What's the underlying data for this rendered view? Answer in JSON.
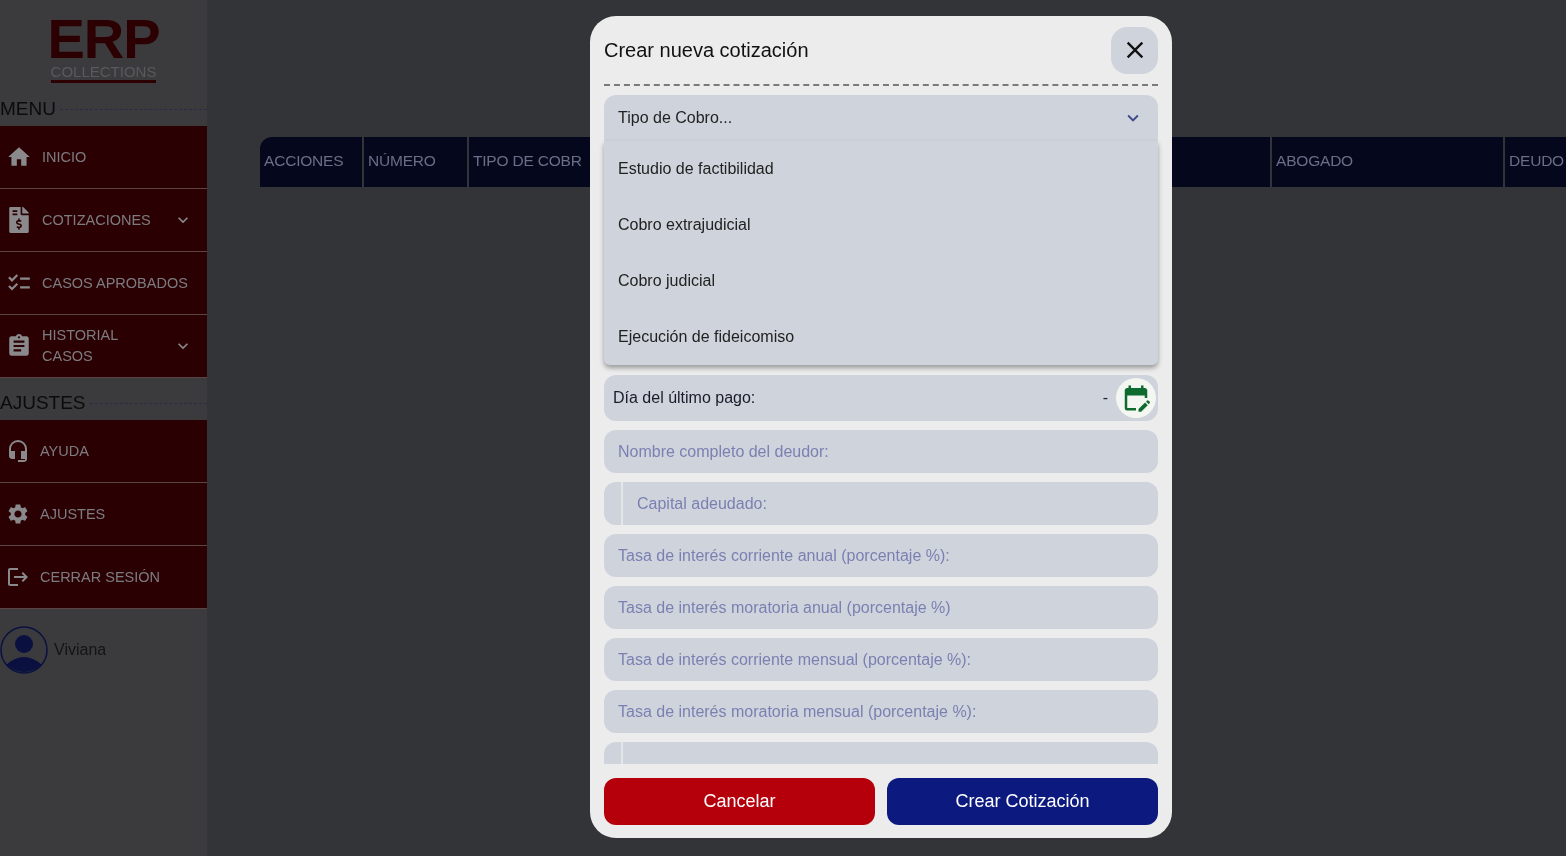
{
  "sidebar": {
    "logo": {
      "title": "ERP",
      "subtitle": "COLLECTIONS"
    },
    "sections": [
      {
        "title": "MENU",
        "items": [
          {
            "label": "INICIO",
            "has_submenu": false
          },
          {
            "label": "COTIZACIONES",
            "has_submenu": true
          },
          {
            "label": "CASOS APROBADOS",
            "has_submenu": false
          },
          {
            "label": "HISTORIAL CASOS",
            "has_submenu": true
          }
        ]
      },
      {
        "title": "AJUSTES",
        "items": [
          {
            "label": "AYUDA",
            "has_submenu": false
          },
          {
            "label": "AJUSTES",
            "has_submenu": false
          },
          {
            "label": "CERRAR SESIÓN",
            "has_submenu": false
          }
        ]
      }
    ],
    "user": {
      "name": "Viviana"
    }
  },
  "table": {
    "columns": [
      "ACCIONES",
      "NÚMERO",
      "TIPO DE COBR",
      "ABOGADO",
      "DEUDO"
    ]
  },
  "modal": {
    "title": "Crear nueva cotización",
    "select": {
      "placeholder": "Tipo de Cobro...",
      "expanded": true,
      "options": [
        "Estudio de factibilidad",
        "Cobro extrajudicial",
        "Cobro judicial",
        "Ejecución de fideicomiso"
      ]
    },
    "fields": [
      {
        "kind": "date",
        "label": "Día del último pago:",
        "value": "-"
      },
      {
        "kind": "text",
        "placeholder": "Nombre completo del deudor:"
      },
      {
        "kind": "money",
        "placeholder": "Capital adeudado:"
      },
      {
        "kind": "text",
        "placeholder": "Tasa de interés corriente anual (porcentaje %):"
      },
      {
        "kind": "text",
        "placeholder": "Tasa de interés moratoria anual (porcentaje %)"
      },
      {
        "kind": "text",
        "placeholder": "Tasa de interés corriente mensual (porcentaje %):"
      },
      {
        "kind": "text",
        "placeholder": "Tasa de interés moratoria mensual (porcentaje %):"
      },
      {
        "kind": "money"
      }
    ],
    "buttons": [
      {
        "kind": "cancel",
        "label": "Cancelar"
      },
      {
        "kind": "primary",
        "label": "Crear Cotización"
      }
    ]
  }
}
